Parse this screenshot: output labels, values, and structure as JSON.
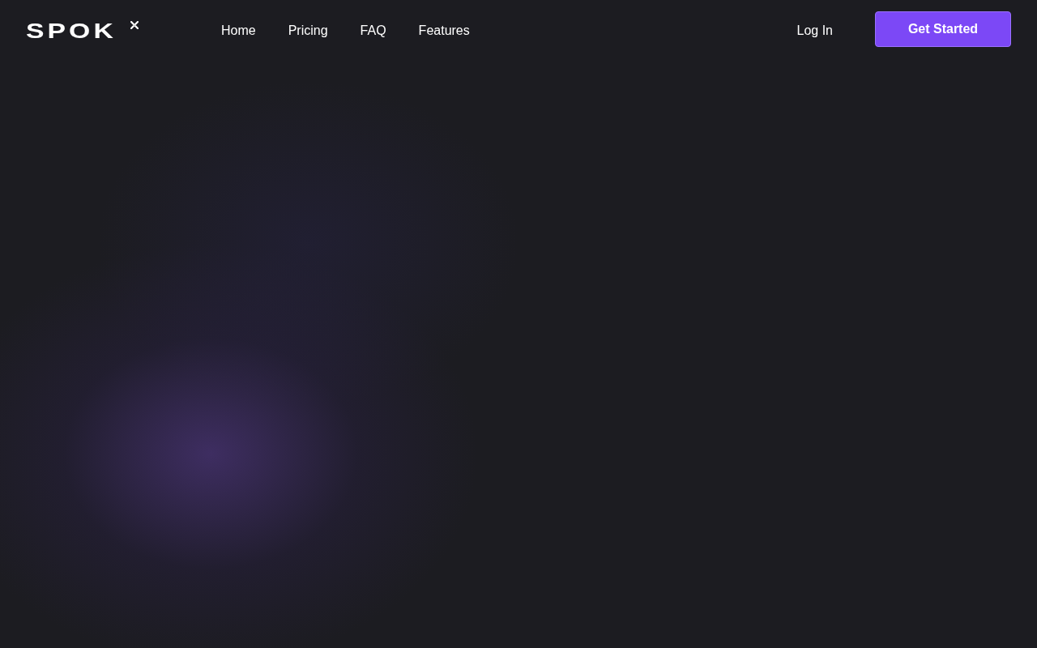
{
  "logo": {
    "text": "SPOK"
  },
  "nav": [
    {
      "label": "Home"
    },
    {
      "label": "Pricing"
    },
    {
      "label": "FAQ"
    },
    {
      "label": "Features"
    }
  ],
  "login": "Log In",
  "cta": "Get Started"
}
